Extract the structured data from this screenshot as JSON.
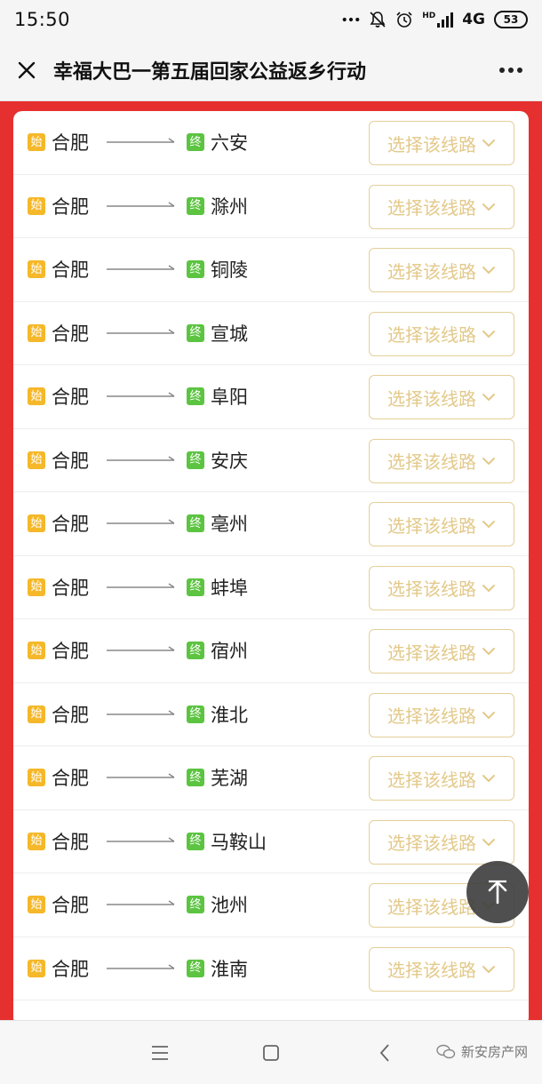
{
  "status_bar": {
    "time": "15:50",
    "hd_label": "HD",
    "network": "4G",
    "battery": "53"
  },
  "nav": {
    "title": "幸福大巴一第五届回家公益返乡行动"
  },
  "badges": {
    "start": "始",
    "end": "终"
  },
  "routes": [
    {
      "from": "合肥",
      "to": "六安",
      "action": "选择该线路"
    },
    {
      "from": "合肥",
      "to": "滁州",
      "action": "选择该线路"
    },
    {
      "from": "合肥",
      "to": "铜陵",
      "action": "选择该线路"
    },
    {
      "from": "合肥",
      "to": "宣城",
      "action": "选择该线路"
    },
    {
      "from": "合肥",
      "to": "阜阳",
      "action": "选择该线路"
    },
    {
      "from": "合肥",
      "to": "安庆",
      "action": "选择该线路"
    },
    {
      "from": "合肥",
      "to": "亳州",
      "action": "选择该线路"
    },
    {
      "from": "合肥",
      "to": "蚌埠",
      "action": "选择该线路"
    },
    {
      "from": "合肥",
      "to": "宿州",
      "action": "选择该线路"
    },
    {
      "from": "合肥",
      "to": "淮北",
      "action": "选择该线路"
    },
    {
      "from": "合肥",
      "to": "芜湖",
      "action": "选择该线路"
    },
    {
      "from": "合肥",
      "to": "马鞍山",
      "action": "选择该线路"
    },
    {
      "from": "合肥",
      "to": "池州",
      "action": "选择该线路"
    },
    {
      "from": "合肥",
      "to": "淮南",
      "action": "选择该线路"
    }
  ],
  "watermark": {
    "text": "新安房产网"
  },
  "colors": {
    "page_bg": "#e63030",
    "start_badge": "#f5b82a",
    "end_badge": "#5cc441",
    "select_border": "#e4cf98",
    "select_text": "#e3c98a"
  },
  "icons": {
    "close": "close-icon",
    "more": "more-dots-icon",
    "start": "start-badge",
    "end": "end-badge",
    "arrow": "arrow-right-icon",
    "dropdown": "chevron-down-icon",
    "back_to_top": "arrow-up-icon",
    "menu": "menu-lines-icon",
    "home": "square-home-icon",
    "back": "chevron-left-icon"
  }
}
